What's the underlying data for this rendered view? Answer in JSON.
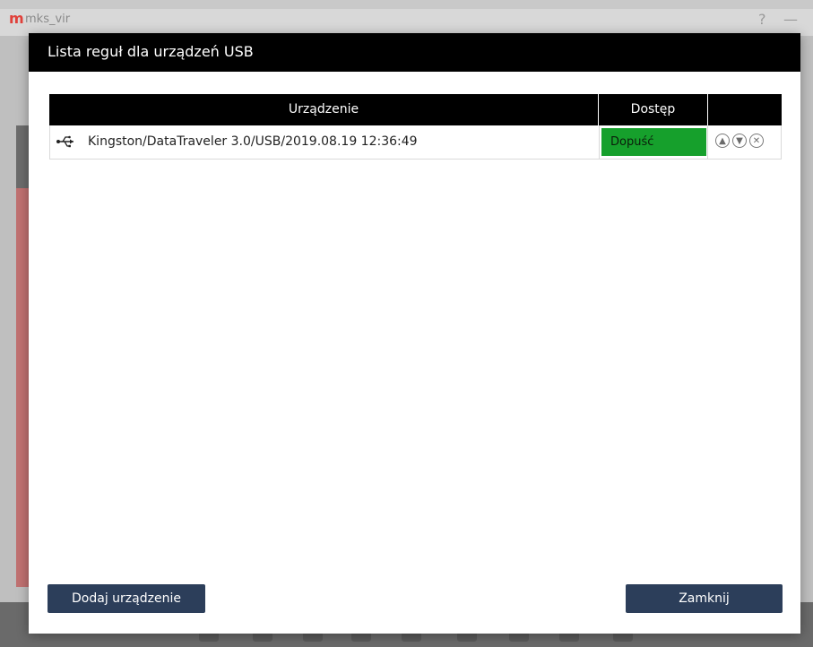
{
  "background_window": {
    "title": "mks_vir",
    "logo": "m",
    "help_icon": "?",
    "minimize_icon": "—"
  },
  "dialog": {
    "title": "Lista reguł dla urządzeń USB",
    "table": {
      "columns": {
        "device": "Urządzenie",
        "access": "Dostęp"
      },
      "rows": [
        {
          "device": "Kingston/DataTraveler 3.0/USB/2019.08.19 12:36:49",
          "access": "Dopuść",
          "access_color": "#16a02c"
        }
      ]
    },
    "buttons": {
      "add": "Dodaj urządzenie",
      "close": "Zamknij"
    }
  },
  "colors": {
    "header_bg": "#000000",
    "button_bg": "#2c3e5a",
    "allow_green": "#16a02c"
  }
}
